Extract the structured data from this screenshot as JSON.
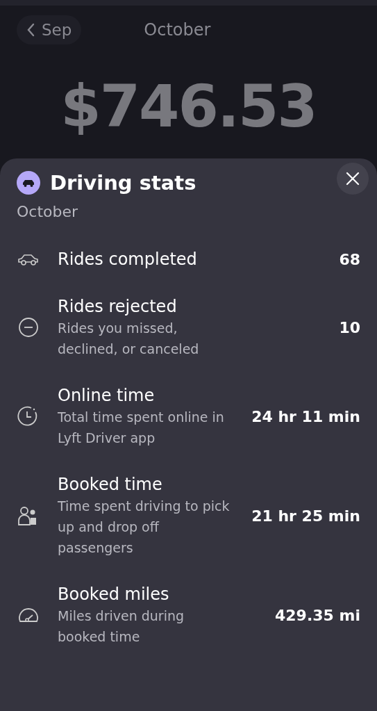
{
  "header": {
    "back_label": "Sep",
    "month": "October",
    "amount": "$746.53"
  },
  "sheet": {
    "title": "Driving stats",
    "subtitle": "October"
  },
  "stats": [
    {
      "kind": "car",
      "label": "Rides completed",
      "value": "68"
    },
    {
      "kind": "rejected",
      "label": "Rides rejected",
      "description": "Rides you missed, declined, or canceled",
      "value": "10"
    },
    {
      "kind": "clock",
      "label": "Online time",
      "description": "Total time spent online in Lyft Driver app",
      "value": "24 hr 11 min"
    },
    {
      "kind": "people",
      "label": "Booked time",
      "description": "Time spent driving to pick up and drop off passengers",
      "value": "21 hr 25 min"
    },
    {
      "kind": "gauge",
      "label": "Booked miles",
      "description": "Miles driven during booked time",
      "value": "429.35 mi"
    }
  ]
}
